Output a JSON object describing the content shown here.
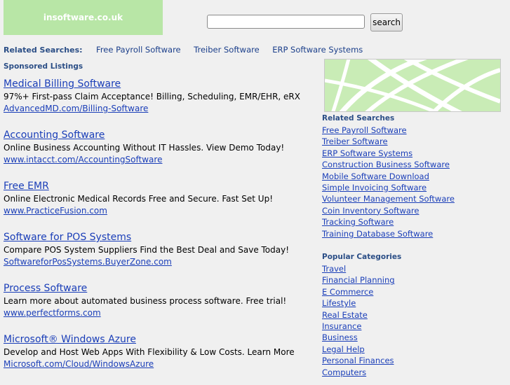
{
  "header": {
    "logo_text": "insoftware.co.uk",
    "search": {
      "value": "",
      "placeholder": ""
    },
    "search_button": "search"
  },
  "related_top": {
    "label": "Related Searches:",
    "links": [
      "Free Payroll Software",
      "Treiber Software",
      "ERP Software Systems"
    ]
  },
  "sponsored": {
    "label": "Sponsored Listings",
    "listings": [
      {
        "title": "Medical Billing Software",
        "desc": "97%+ First-pass Claim Acceptance! Billing, Scheduling, EMR/EHR, eRX",
        "url": "AdvancedMD.com/Billing-Software"
      },
      {
        "title": "Accounting Software",
        "desc": "Online Business Accounting Without IT Hassles. View Demo Today!",
        "url": "www.intacct.com/AccountingSoftware"
      },
      {
        "title": "Free EMR",
        "desc": "Online Electronic Medical Records Free and Secure. Fast Set Up!",
        "url": "www.PracticeFusion.com"
      },
      {
        "title": "Software for POS Systems",
        "desc": "Compare POS System Suppliers Find the Best Deal and Save Today!",
        "url": "SoftwareforPosSystems.BuyerZone.com"
      },
      {
        "title": "Process Software",
        "desc": "Learn more about automated business process software. Free trial!",
        "url": "www.perfectforms.com"
      },
      {
        "title": "Microsoft® Windows Azure",
        "desc": "Develop and Host Web Apps With Flexibility & Low Costs. Learn More",
        "url": "Microsoft.com/Cloud/WindowsAzure"
      }
    ]
  },
  "sidebar": {
    "related_heading": "Related Searches",
    "related_links": [
      "Free Payroll Software",
      "Treiber Software",
      "ERP Software Systems",
      "Construction Business Software",
      "Mobile Software Download",
      "Simple Invoicing Software",
      "Volunteer Management Software",
      "Coin Inventory Software",
      "Tracking Software",
      "Training Database Software"
    ],
    "popular_heading": "Popular Categories",
    "popular_links": [
      "Travel",
      "Financial Planning",
      "E Commerce",
      "Lifestyle",
      "Real Estate",
      "Insurance",
      "Business",
      "Legal Help",
      "Personal Finances",
      "Computers"
    ]
  },
  "colors": {
    "background": "#f0f0f0",
    "logo_green": "#b8e6a6",
    "link_blue": "#1a3eb8",
    "heading_blue": "#2b4e86"
  }
}
